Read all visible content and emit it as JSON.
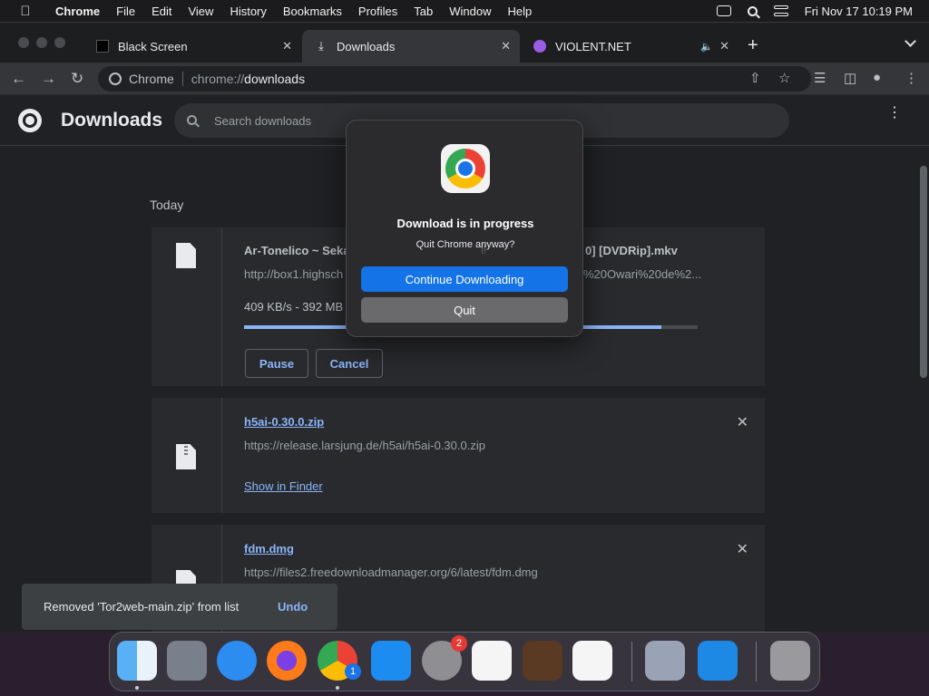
{
  "menubar": {
    "apple": "",
    "app_name": "Chrome",
    "items": [
      "File",
      "Edit",
      "View",
      "History",
      "Bookmarks",
      "Profiles",
      "Tab",
      "Window",
      "Help"
    ],
    "datetime": "Fri Nov 17  10:19 PM"
  },
  "tabs": [
    {
      "title": "Black Screen",
      "close": "✕"
    },
    {
      "title": "Downloads",
      "close": "✕"
    },
    {
      "title": "VIOLENT.NET",
      "close": "✕"
    }
  ],
  "toolbar": {
    "chip": "Chrome",
    "url_scheme": "chrome://",
    "url_host": "downloads"
  },
  "page": {
    "title": "Downloads",
    "search_placeholder": "Search downloads",
    "section": "Today"
  },
  "downloads": [
    {
      "name": "Ar-Tonelico ~ Seka",
      "name_tail": "0] [DVDRip].mkv",
      "url": "http://box1.highsch",
      "url_tail": "%20Owari%20de%2...",
      "status": "409 KB/s - 392 MB",
      "progress": 0.92,
      "pause_label": "Pause",
      "cancel_label": "Cancel"
    },
    {
      "name": "h5ai-0.30.0.zip",
      "url": "https://release.larsjung.de/h5ai/h5ai-0.30.0.zip",
      "action": "Show in Finder"
    },
    {
      "name": "fdm.dmg",
      "url": "https://files2.freedownloadmanager.org/6/latest/fdm.dmg"
    }
  ],
  "toast": {
    "message": "Removed 'Tor2web-main.zip' from list",
    "undo": "Undo"
  },
  "dialog": {
    "title": "Download is in progress",
    "message": "Quit Chrome anyway?",
    "primary": "Continue Downloading",
    "secondary": "Quit"
  },
  "dock": {
    "settings_badge": "2",
    "chrome_badge": "1"
  },
  "colors": {
    "accent": "#8ab4f8",
    "dialog_primary": "#1473e6",
    "page_bg": "#202124"
  }
}
